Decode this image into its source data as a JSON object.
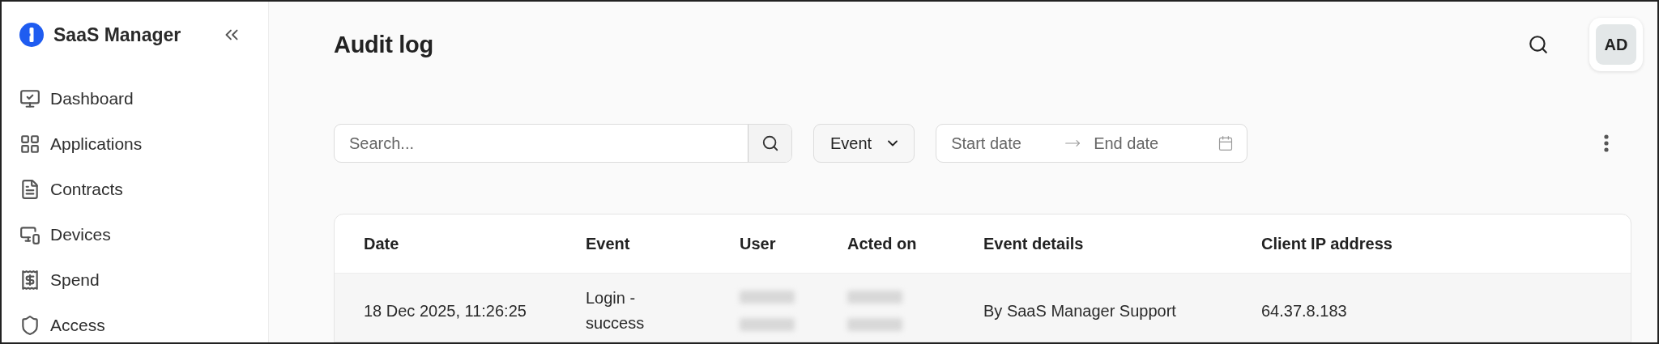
{
  "sidebar": {
    "brand": "SaaS Manager",
    "items": [
      {
        "label": "Dashboard",
        "selected": false
      },
      {
        "label": "Applications",
        "selected": false
      },
      {
        "label": "Contracts",
        "selected": false
      },
      {
        "label": "Devices",
        "selected": false
      },
      {
        "label": "Spend",
        "selected": false
      },
      {
        "label": "Access",
        "selected": false
      }
    ]
  },
  "header": {
    "title": "Audit log",
    "avatar": "AD"
  },
  "toolbar": {
    "search": {
      "placeholder": "Search..."
    },
    "event_filter": "Event",
    "date_range": {
      "start_placeholder": "Start date",
      "end_placeholder": "End date"
    }
  },
  "table": {
    "columns": [
      "Date",
      "Event",
      "User",
      "Acted on",
      "Event details",
      "Client IP address"
    ],
    "rows": [
      {
        "cells": [
          {
            "kind": "text",
            "lines": [
              "18 Dec 2025, 11:26:25"
            ]
          },
          {
            "kind": "text",
            "lines": [
              "Login -",
              "success"
            ]
          },
          {
            "kind": "redacted"
          },
          {
            "kind": "redacted"
          },
          {
            "kind": "text",
            "lines": [
              "By SaaS Manager Support"
            ]
          },
          {
            "kind": "text",
            "lines": [
              "64.37.8.183"
            ]
          }
        ]
      }
    ]
  }
}
